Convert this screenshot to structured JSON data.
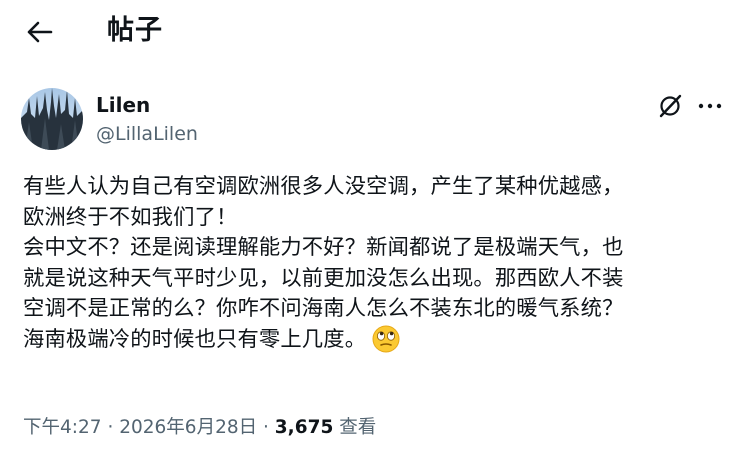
{
  "header": {
    "title": "帖子"
  },
  "author": {
    "display_name": "Lilen",
    "handle": "@LillaLilen"
  },
  "tweet": {
    "text": "有些人认为自己有空调欧洲很多人没空调，产生了某种优越感，\n欧洲终于不如我们了！\n会中文不？还是阅读理解能力不好？新闻都说了是极端天气，也\n就是说这种天气平时少见，以前更加没怎么出现。那西欧人不装\n空调不是正常的么？你咋不问海南人怎么不装东北的暖气系统？\n海南极端冷的时候也只有零上几度。",
    "emoji": "eye-roll-face"
  },
  "meta": {
    "time": "下午4:27",
    "separator": "·",
    "date": "2026年6月28日",
    "views_count": "3,675",
    "views_label": "查看"
  },
  "icons": {
    "back": "back-arrow-icon",
    "grok": "grok-icon",
    "more": "more-icon",
    "emoji": "eye-roll-emoji-icon"
  },
  "colors": {
    "text_primary": "#0f1419",
    "text_secondary": "#536471",
    "background": "#ffffff",
    "emoji_face": "#fbc932"
  }
}
